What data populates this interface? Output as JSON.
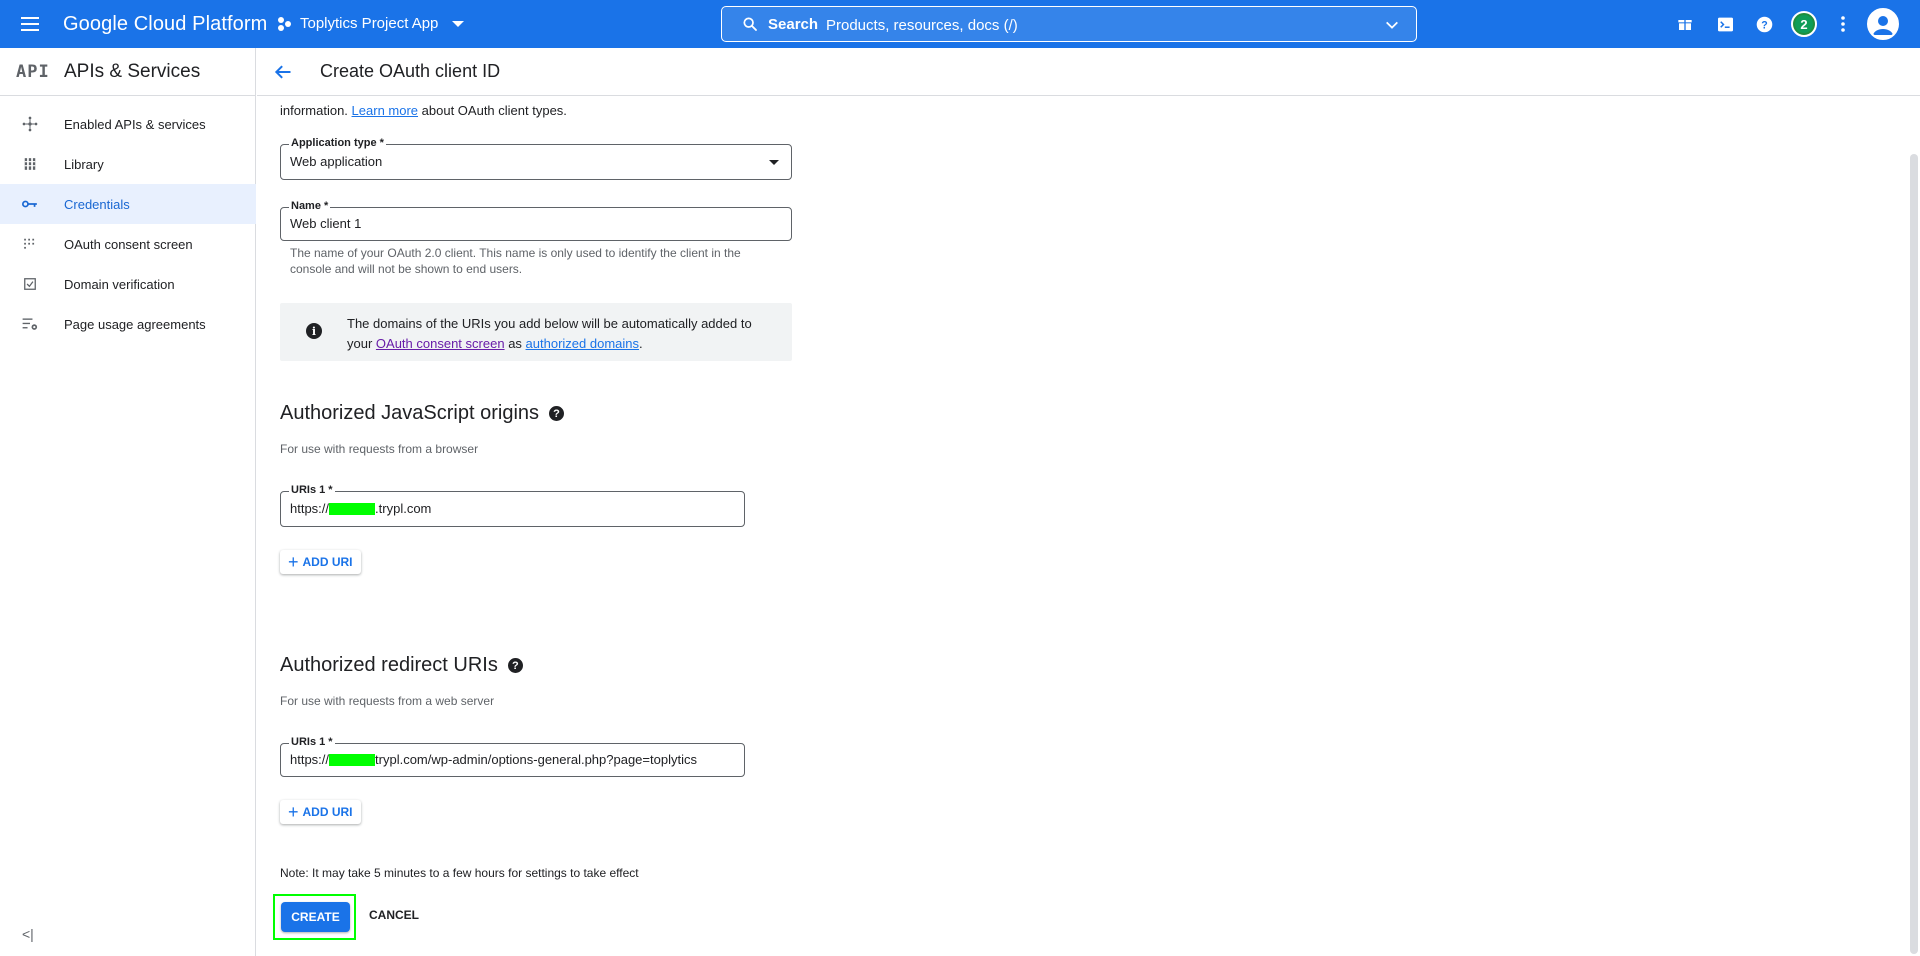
{
  "topbar": {
    "brand": "Google Cloud Platform",
    "project": "Toplytics Project App",
    "search_label": "Search",
    "search_placeholder": "Products, resources, docs (/)",
    "notification_count": "2"
  },
  "sidebar": {
    "logo": "API",
    "title": "APIs & Services",
    "items": [
      {
        "label": "Enabled APIs & services",
        "icon": "hub-icon"
      },
      {
        "label": "Library",
        "icon": "library-icon"
      },
      {
        "label": "Credentials",
        "icon": "key-icon",
        "active": true
      },
      {
        "label": "OAuth consent screen",
        "icon": "consent-icon"
      },
      {
        "label": "Domain verification",
        "icon": "checkbox-icon"
      },
      {
        "label": "Page usage agreements",
        "icon": "settings-list-icon"
      }
    ],
    "collapse_glyph": "<|"
  },
  "header": {
    "title": "Create OAuth client ID"
  },
  "form": {
    "intro_prefix": "information.",
    "intro_link": "Learn more",
    "intro_suffix": "about OAuth client types.",
    "app_type_label": "Application type *",
    "app_type_value": "Web application",
    "name_label": "Name *",
    "name_value": "Web client 1",
    "name_help": "The name of your OAuth 2.0 client. This name is only used to identify the client in the console and will not be shown to end users.",
    "info_text_1": "The domains of the URIs you add below will be automatically added to your",
    "info_link_1": "OAuth consent screen",
    "info_text_2": "as",
    "info_link_2": "authorized domains",
    "info_text_3": ".",
    "js_origins_title": "Authorized JavaScript origins",
    "js_origins_desc": "For use with requests from a browser",
    "js_uri_label": "URIs 1 *",
    "js_uri_prefix": "https://",
    "js_uri_suffix": ".trypl.com",
    "add_uri_label": "ADD URI",
    "redirect_title": "Authorized redirect URIs",
    "redirect_desc": "For use with requests from a web server",
    "redirect_uri_label": "URIs 1 *",
    "redirect_uri_prefix": "https://",
    "redirect_uri_suffix": "trypl.com/wp-admin/options-general.php?page=toplytics",
    "note": "Note: It may take 5 minutes to a few hours for settings to take effect",
    "create_label": "CREATE",
    "cancel_label": "CANCEL"
  },
  "colors": {
    "primary": "#1a73e8",
    "highlight": "#00ff00",
    "active_bg": "#e8f0fe"
  }
}
